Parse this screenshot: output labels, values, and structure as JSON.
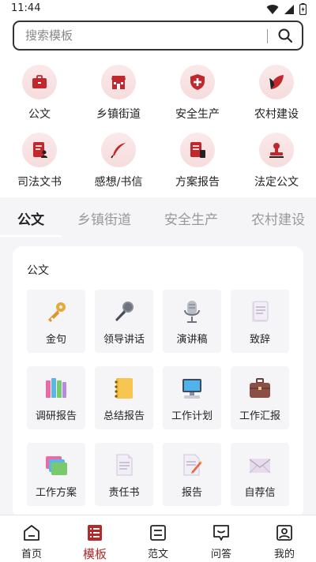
{
  "status": {
    "time": "11:44"
  },
  "search": {
    "placeholder": "搜索模板"
  },
  "quick_links": [
    {
      "label": "公文",
      "icon": "briefcase-icon"
    },
    {
      "label": "乡镇街道",
      "icon": "storefront-icon"
    },
    {
      "label": "安全生产",
      "icon": "shield-icon"
    },
    {
      "label": "农村建设",
      "icon": "leaf-icon"
    },
    {
      "label": "司法文书",
      "icon": "document-person-icon"
    },
    {
      "label": "感想/书信",
      "icon": "quill-icon"
    },
    {
      "label": "方案报告",
      "icon": "report-icon"
    },
    {
      "label": "法定公文",
      "icon": "stamp-icon"
    }
  ],
  "tabs": [
    {
      "label": "公文",
      "active": true
    },
    {
      "label": "乡镇街道",
      "active": false
    },
    {
      "label": "安全生产",
      "active": false
    },
    {
      "label": "农村建设",
      "active": false
    }
  ],
  "card": {
    "title": "公文",
    "items": [
      {
        "label": "金句",
        "icon": "key-icon"
      },
      {
        "label": "领导讲话",
        "icon": "microphone-icon"
      },
      {
        "label": "演讲稿",
        "icon": "studio-mic-icon"
      },
      {
        "label": "致辞",
        "icon": "page-icon"
      },
      {
        "label": "调研报告",
        "icon": "binders-icon"
      },
      {
        "label": "总结报告",
        "icon": "notebook-icon"
      },
      {
        "label": "工作计划",
        "icon": "computer-icon"
      },
      {
        "label": "工作汇报",
        "icon": "suitcase-icon"
      },
      {
        "label": "工作方案",
        "icon": "folders-icon"
      },
      {
        "label": "责任书",
        "icon": "document-icon"
      },
      {
        "label": "报告",
        "icon": "pencil-doc-icon"
      },
      {
        "label": "自荐信",
        "icon": "envelope-icon"
      }
    ]
  },
  "bottom_nav": [
    {
      "label": "首页",
      "icon": "home-icon",
      "active": false
    },
    {
      "label": "模板",
      "icon": "template-icon",
      "active": true
    },
    {
      "label": "范文",
      "icon": "article-icon",
      "active": false
    },
    {
      "label": "问答",
      "icon": "chat-icon",
      "active": false
    },
    {
      "label": "我的",
      "icon": "profile-icon",
      "active": false
    }
  ],
  "colors": {
    "accent": "#b22a2a",
    "icon_bg": "#f8e1e2",
    "panel_bg": "#f5f5f7"
  }
}
